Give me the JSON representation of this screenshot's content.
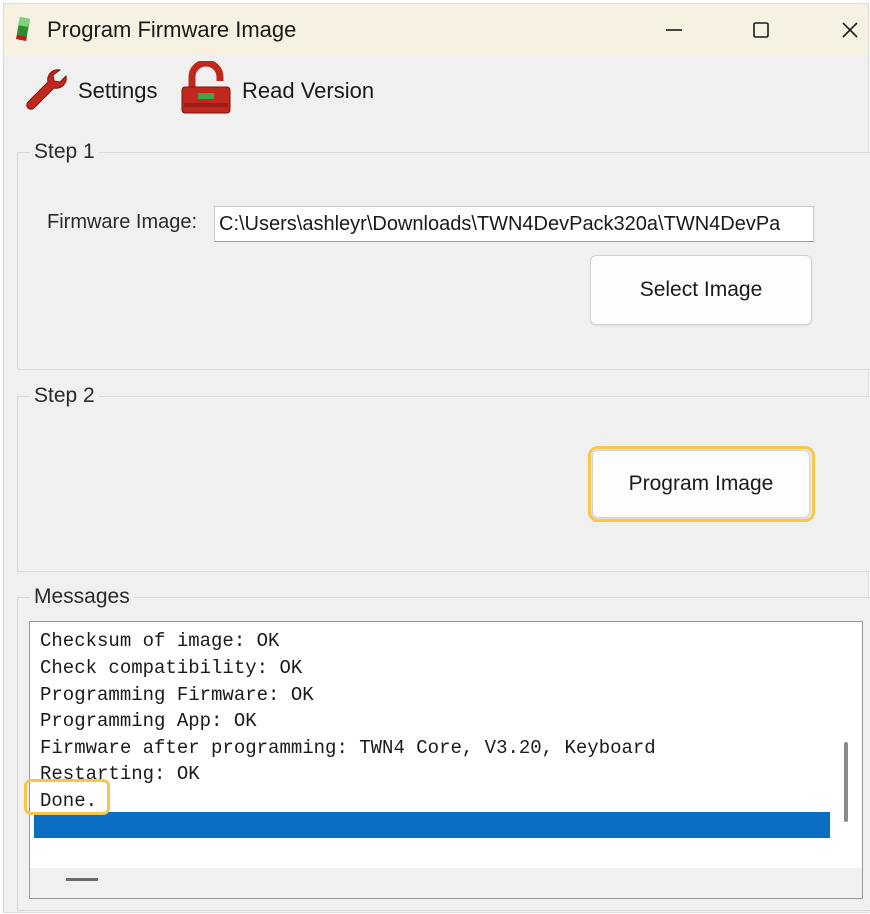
{
  "window": {
    "title": "Program Firmware Image",
    "icons": {
      "app": "firmware-chip-icon",
      "minimize": "minimize-icon",
      "maximize": "maximize-icon",
      "close": "close-icon"
    }
  },
  "toolbar": {
    "settings_label": "Settings",
    "settings_icon": "wrench-icon",
    "read_version_label": "Read Version",
    "read_version_icon": "padlock-icon"
  },
  "step1": {
    "title": "Step 1",
    "firmware_label": "Firmware Image:",
    "firmware_path": "C:\\Users\\ashleyr\\Downloads\\TWN4DevPack320a\\TWN4DevPa",
    "select_button": "Select Image"
  },
  "step2": {
    "title": "Step 2",
    "program_button": "Program Image"
  },
  "messages": {
    "title": "Messages",
    "lines": [
      "Checksum of image: OK",
      "Check compatibility: OK",
      "Programming Firmware: OK",
      "Programming App: OK",
      "Firmware after programming: TWN4 Core, V3.20, Keyboard",
      "Restarting: OK",
      "Done."
    ]
  },
  "colors": {
    "highlight": "#f7c64a",
    "selection": "#0a6fc2",
    "titlebar": "#f7f1e1"
  }
}
